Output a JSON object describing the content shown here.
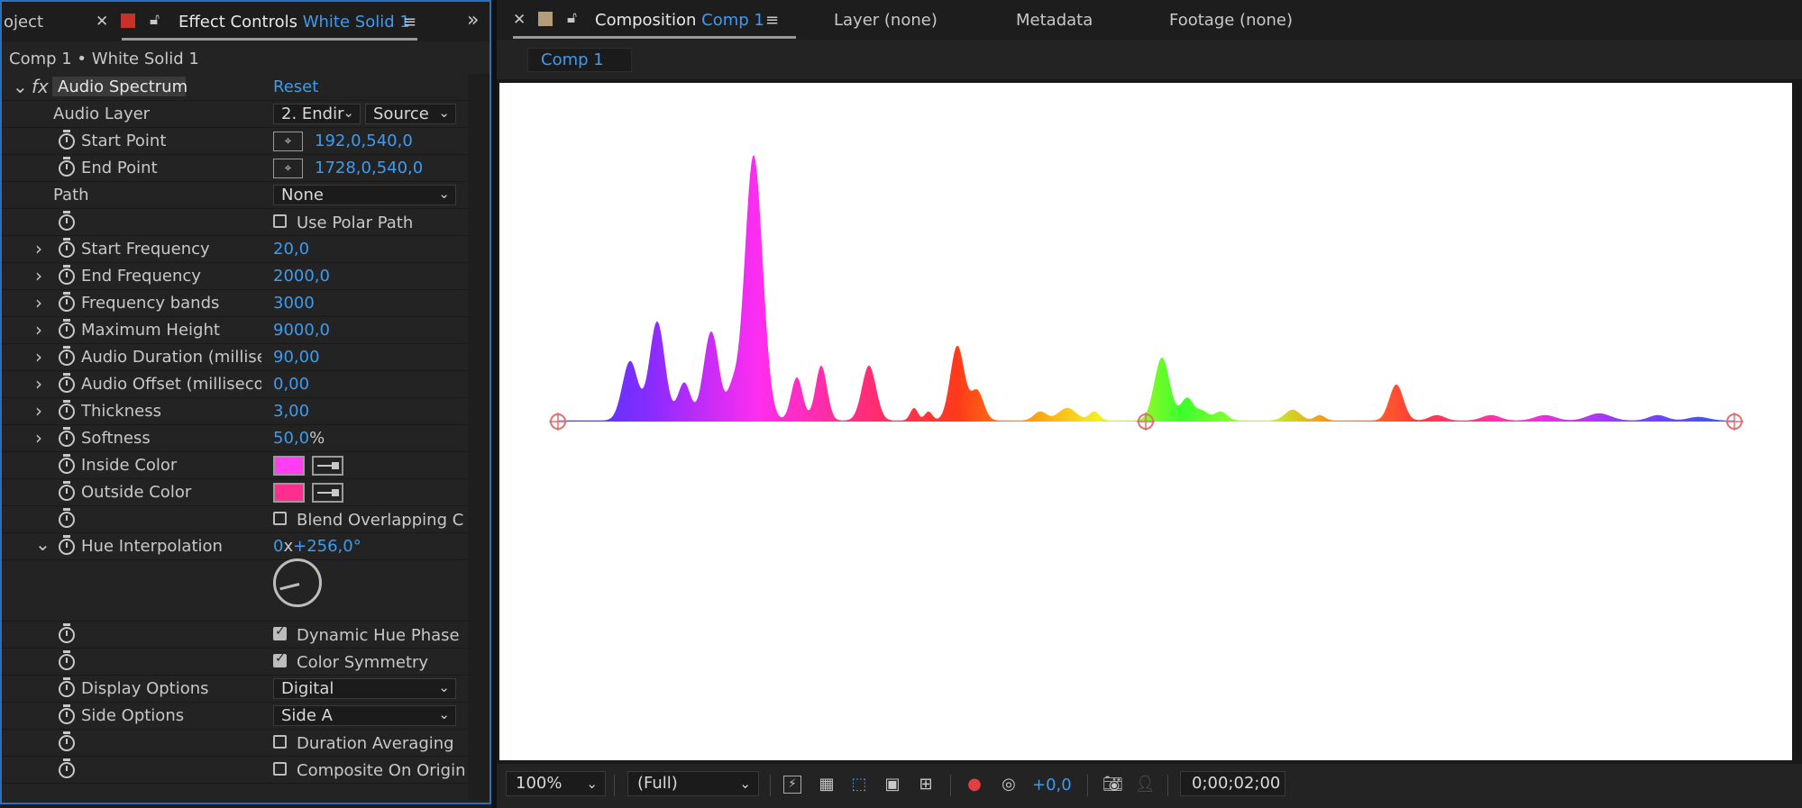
{
  "left_tabs": {
    "project_tab_partial": "oject",
    "effect_controls_label": "Effect Controls",
    "effect_controls_layer": "White Solid 1"
  },
  "breadcrumb": "Comp 1 • White Solid 1",
  "effect": {
    "fx_label": "fx",
    "name": "Audio Spectrum",
    "reset_label": "Reset"
  },
  "properties": {
    "audio_layer": {
      "label": "Audio Layer",
      "layer_value": "2. Endir",
      "source_value": "Source"
    },
    "start_point": {
      "label": "Start Point",
      "value": "192,0,540,0"
    },
    "end_point": {
      "label": "End Point",
      "value": "1728,0,540,0"
    },
    "path": {
      "label": "Path",
      "value": "None"
    },
    "use_polar_path": {
      "label": "Use Polar Path",
      "checked": false
    },
    "start_frequency": {
      "label": "Start Frequency",
      "value": "20,0"
    },
    "end_frequency": {
      "label": "End Frequency",
      "value": "2000,0"
    },
    "frequency_bands": {
      "label": "Frequency bands",
      "value": "3000"
    },
    "maximum_height": {
      "label": "Maximum Height",
      "value": "9000,0"
    },
    "audio_duration": {
      "label": "Audio Duration (millisec",
      "value": "90,00"
    },
    "audio_offset": {
      "label": "Audio Offset (millisecon",
      "value": "0,00"
    },
    "thickness": {
      "label": "Thickness",
      "value": "3,00"
    },
    "softness": {
      "label": "Softness",
      "value": "50,0",
      "unit": "%"
    },
    "inside_color": {
      "label": "Inside Color",
      "color": "#ff3df2"
    },
    "outside_color": {
      "label": "Outside Color",
      "color": "#ff2d8e"
    },
    "blend_overlapping": {
      "label": "Blend Overlapping C",
      "checked": false
    },
    "hue_interpolation": {
      "label": "Hue Interpolation",
      "revolutions": "0",
      "x": "x",
      "degrees": "+256,0°"
    },
    "dynamic_hue_phase": {
      "label": "Dynamic Hue Phase",
      "checked": true
    },
    "color_symmetry": {
      "label": "Color Symmetry",
      "checked": true
    },
    "display_options": {
      "label": "Display Options",
      "value": "Digital"
    },
    "side_options": {
      "label": "Side Options",
      "value": "Side A"
    },
    "duration_averaging": {
      "label": "Duration Averaging",
      "checked": false
    },
    "composite_on_origin": {
      "label": "Composite On Origin",
      "checked": false
    }
  },
  "right_tabs": {
    "composition_label": "Composition",
    "composition_name": "Comp 1",
    "layer_tab": "Layer (none)",
    "metadata_tab": "Metadata",
    "footage_tab": "Footage (none)"
  },
  "comp_chip": "Comp 1",
  "viewer": {
    "zoom": "100%",
    "resolution": "(Full)",
    "exposure": "+0,0",
    "timecode": "0;00;02;00"
  },
  "colors": {
    "accent_blue": "#3d9bf0",
    "panel_border": "#2f6fb9",
    "effect_label_red": "#c8312a",
    "comp_icon_tan": "#b39c77"
  }
}
